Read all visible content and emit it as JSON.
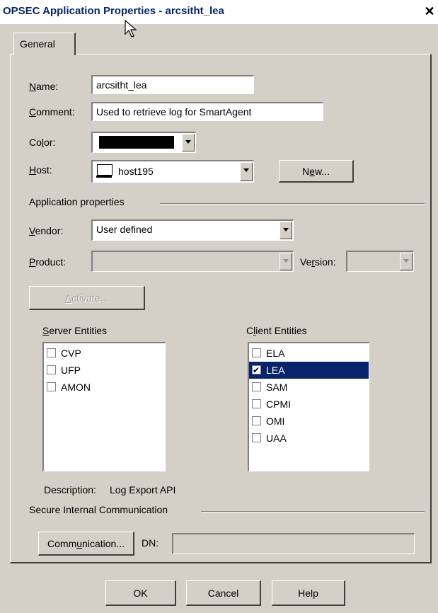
{
  "window": {
    "title": "OPSEC Application Properties - arcsitht_lea",
    "close_glyph": "✕"
  },
  "tabs": [
    {
      "label": "General"
    }
  ],
  "form": {
    "name_label": "Name:",
    "name_value": "arcsitht_lea",
    "comment_label": "Comment:",
    "comment_value": "Used to retrieve log for SmartAgent",
    "color_label": "Color:",
    "color_value": "#000000",
    "host_label": "Host:",
    "host_value": "host195",
    "new_button": "New..."
  },
  "app_props": {
    "heading": "Application properties",
    "vendor_label": "Vendor:",
    "vendor_value": "User defined",
    "product_label": "Product:",
    "product_value": "",
    "version_label": "Version:",
    "version_value": "",
    "activate_button": "Activate..."
  },
  "server_entities": {
    "label": "Server Entities",
    "items": [
      {
        "label": "CVP",
        "checked": false
      },
      {
        "label": "UFP",
        "checked": false
      },
      {
        "label": "AMON",
        "checked": false
      }
    ]
  },
  "client_entities": {
    "label": "Client Entities",
    "items": [
      {
        "label": "ELA",
        "checked": false
      },
      {
        "label": "LEA",
        "checked": true,
        "selected": true
      },
      {
        "label": "SAM",
        "checked": false
      },
      {
        "label": "CPMI",
        "checked": false
      },
      {
        "label": "OMI",
        "checked": false
      },
      {
        "label": "UAA",
        "checked": false
      }
    ]
  },
  "description": {
    "label": "Description:",
    "value": "Log Export API"
  },
  "sic": {
    "heading": "Secure Internal Communication",
    "communication_button": "Communication...",
    "dn_label": "DN:",
    "dn_value": ""
  },
  "footer": {
    "ok": "OK",
    "cancel": "Cancel",
    "help": "Help"
  },
  "colors": {
    "titlebar_text": "#0a246a",
    "dialog_bg": "#d4d0c8",
    "selection": "#0a246a"
  }
}
